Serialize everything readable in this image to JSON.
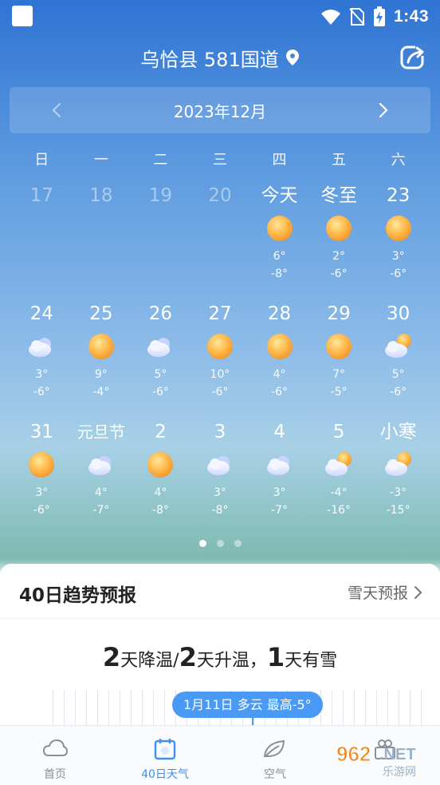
{
  "status": {
    "time": "1:43"
  },
  "header": {
    "location": "乌恰县 581国道"
  },
  "month": {
    "label": "2023年12月"
  },
  "weekdays": [
    "日",
    "一",
    "二",
    "三",
    "四",
    "五",
    "六"
  ],
  "weeks": [
    [
      {
        "label": "17",
        "past": true
      },
      {
        "label": "18",
        "past": true
      },
      {
        "label": "19",
        "past": true
      },
      {
        "label": "20",
        "past": true
      },
      {
        "label": "今天",
        "icon": "sun-icon",
        "high": "6°",
        "low": "-8°"
      },
      {
        "label": "冬至",
        "icon": "sun-icon",
        "high": "2°",
        "low": "-6°"
      },
      {
        "label": "23",
        "icon": "sun-icon",
        "high": "3°",
        "low": "-6°"
      }
    ],
    [
      {
        "label": "24",
        "icon": "cloud-icon",
        "high": "3°",
        "low": "-6°"
      },
      {
        "label": "25",
        "icon": "sun-icon",
        "high": "9°",
        "low": "-4°"
      },
      {
        "label": "26",
        "icon": "cloud-icon",
        "high": "5°",
        "low": "-6°"
      },
      {
        "label": "27",
        "icon": "sun-icon",
        "high": "10°",
        "low": "-6°"
      },
      {
        "label": "28",
        "icon": "sun-icon",
        "high": "4°",
        "low": "-6°"
      },
      {
        "label": "29",
        "icon": "sun-icon",
        "high": "7°",
        "low": "-5°"
      },
      {
        "label": "30",
        "icon": "partly-cloudy-icon",
        "high": "5°",
        "low": "-6°"
      }
    ],
    [
      {
        "label": "31",
        "icon": "sun-icon",
        "high": "3°",
        "low": "-6°"
      },
      {
        "label": "元旦节",
        "icon": "cloud-icon",
        "high": "4°",
        "low": "-7°"
      },
      {
        "label": "2",
        "icon": "sun-icon",
        "high": "4°",
        "low": "-8°"
      },
      {
        "label": "3",
        "icon": "cloud-icon",
        "high": "3°",
        "low": "-8°"
      },
      {
        "label": "4",
        "icon": "cloud-icon",
        "high": "3°",
        "low": "-7°"
      },
      {
        "label": "5",
        "icon": "partly-cloudy-icon",
        "high": "-4°",
        "low": "-16°"
      },
      {
        "label": "小寒",
        "icon": "partly-cloudy-icon",
        "high": "-3°",
        "low": "-15°"
      }
    ]
  ],
  "pager": {
    "count": 3,
    "active": 0
  },
  "forecast": {
    "title": "40日趋势预报",
    "link": "雪天预报",
    "cooling_days": "2",
    "cooling_text": "天降温/",
    "warming_days": "2",
    "warming_text": "天升温，",
    "snow_days": "1",
    "snow_text": "天有雪",
    "tooltip": "1月11日 多云 最高-5°"
  },
  "nav": {
    "items": [
      {
        "label": "首页",
        "icon": "cloud-outline-icon",
        "active": false
      },
      {
        "label": "40日天气",
        "icon": "calendar-icon",
        "active": true
      },
      {
        "label": "空气",
        "icon": "leaf-icon",
        "active": false
      },
      {
        "label": "",
        "icon": "gift-icon",
        "active": false
      }
    ]
  },
  "colors": {
    "accent": "#3f8ff0",
    "sky_top": "#2f74d4",
    "sun": "#f6a73b"
  },
  "watermark": "962.NET 乐游网"
}
